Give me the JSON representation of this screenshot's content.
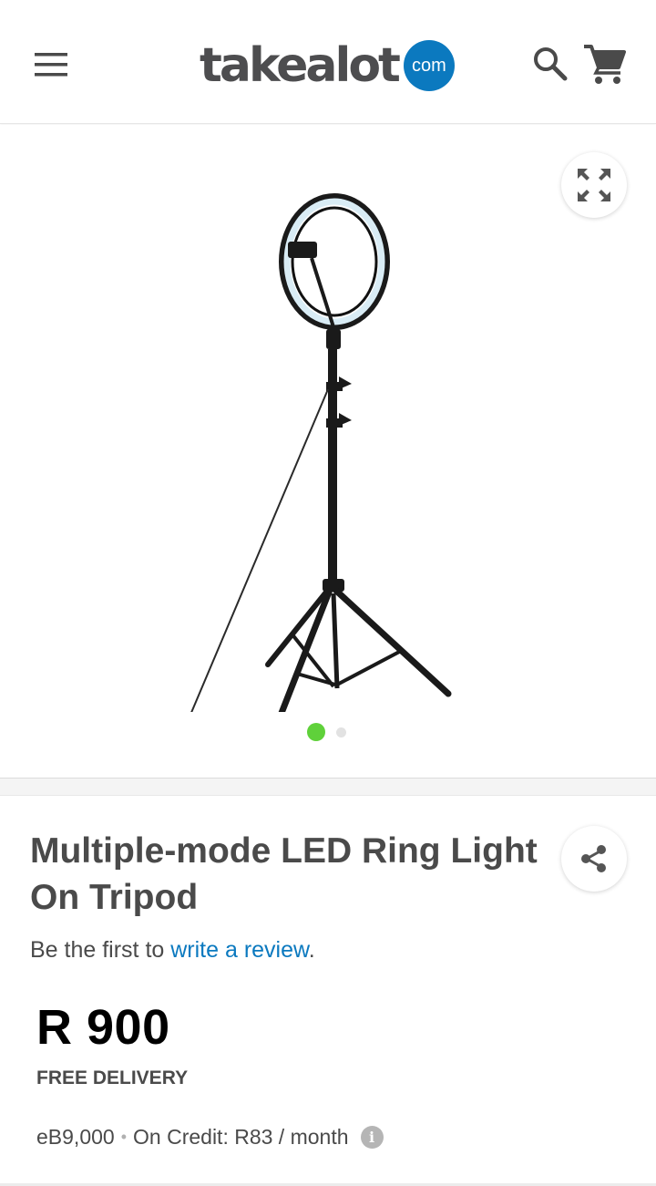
{
  "header": {
    "logo_word": "takealot",
    "logo_badge": "com",
    "icons": {
      "menu": "hamburger-menu-icon",
      "search": "search-icon",
      "cart": "shopping-cart-icon"
    },
    "brand_color": "#0b79bf"
  },
  "gallery": {
    "image_subject": "ring-light-on-tripod",
    "expand_icon": "expand-fullscreen-icon",
    "slide_count": 2,
    "active_slide": 1,
    "active_dot_color": "#5fd13a"
  },
  "product": {
    "title": "Multiple-mode LED Ring Light On Tripod",
    "review_prefix": "Be the first to ",
    "review_link": "write a review",
    "review_suffix": ".",
    "price": "R 900",
    "delivery": "FREE DELIVERY",
    "ebucks": "eB9,000",
    "separator": "•",
    "credit": "On Credit: R83 / month",
    "info_icon_glyph": "i",
    "share_icon": "share-icon",
    "link_color": "#0b79bf"
  }
}
